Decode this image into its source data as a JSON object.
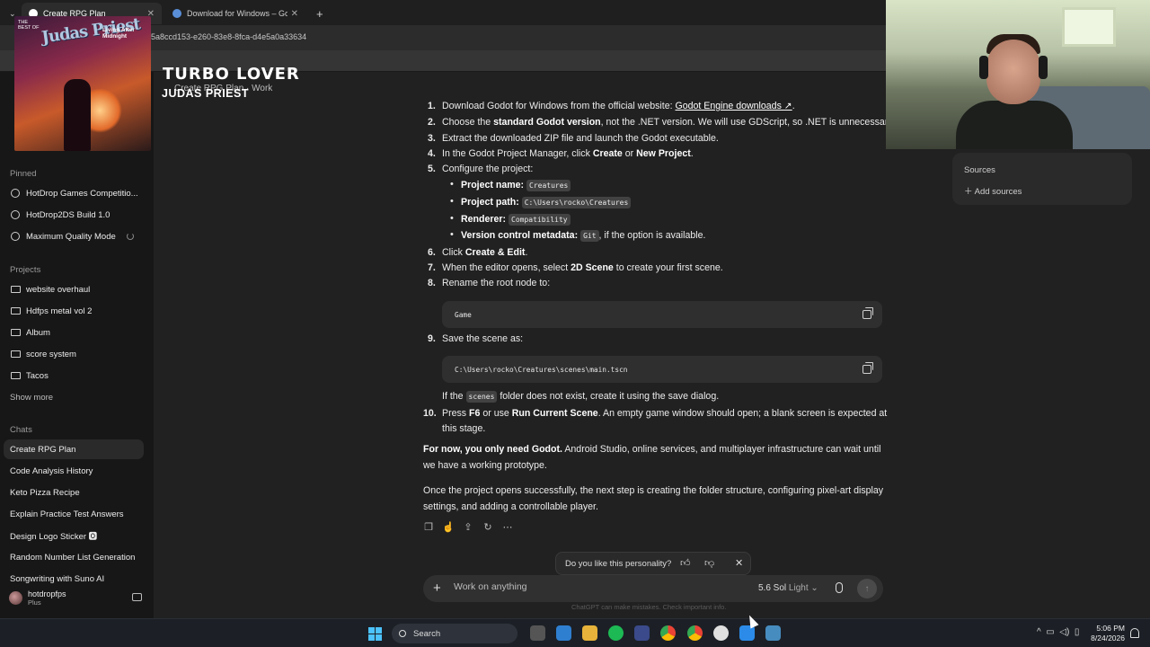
{
  "browser": {
    "tabs": [
      {
        "title": "Create RPG Plan",
        "active": true
      },
      {
        "title": "Download for Windows – Godot",
        "active": false
      }
    ],
    "new_tab": "+",
    "url": "5a8ccd153-e260-83e8-8fca-d4e5a0a33634"
  },
  "overlay": {
    "album_best_of": "THE BEST OF",
    "album_band": "Judas Priest",
    "album_song": "Living After Midnight",
    "now_playing_track": "TURBO LOVER",
    "now_playing_artist": "JUDAS PRIEST"
  },
  "breadcrumb": "Create RPG Plan · Work",
  "sidebar": {
    "pinned_label": "Pinned",
    "pinned": [
      "HotDrop Games Competitio...",
      "HotDrop2DS Build 1.0",
      "Maximum Quality Mode"
    ],
    "projects_label": "Projects",
    "projects": [
      "website overhaul",
      "Hdfps metal vol 2",
      "Album",
      "score system",
      "Tacos"
    ],
    "show_more": "Show more",
    "chats_label": "Chats",
    "chats": [
      "Create RPG Plan",
      "Code Analysis History",
      "Keto Pizza Recipe",
      "Explain Practice Test Answers",
      "Design Logo Sticker 🅾",
      "Random Number List Generation",
      "Songwriting with Suno AI"
    ],
    "user_name": "hotdropfps",
    "user_plan": "Plus"
  },
  "steps": {
    "s1_num": "1.",
    "s1_pre": "Download Godot for Windows from the official website: ",
    "s1_link": "Godot Engine downloads ↗",
    "s1_post": ".",
    "s2_num": "2.",
    "s2_pre": "Choose the ",
    "s2_bold": "standard Godot version",
    "s2_post": ", not the .NET version. We will use GDScript, so .NET is unnecessary.",
    "s3_num": "3.",
    "s3_text": "Extract the downloaded ZIP file and launch the Godot executable.",
    "s4_num": "4.",
    "s4_pre": "In the Godot Project Manager, click ",
    "s4_b1": "Create",
    "s4_mid": " or ",
    "s4_b2": "New Project",
    "s4_post": ".",
    "s5_num": "5.",
    "s5_text": "Configure the project:",
    "cfg_name_label": "Project name:",
    "cfg_name": "Creatures",
    "cfg_path_label": "Project path:",
    "cfg_path": "C:\\Users\\rocko\\Creatures",
    "cfg_renderer_label": "Renderer:",
    "cfg_renderer": "Compatibility",
    "cfg_vcs_label": "Version control metadata:",
    "cfg_vcs": "Git",
    "cfg_vcs_post": ", if the option is available.",
    "s6_num": "6.",
    "s6_pre": "Click ",
    "s6_bold": "Create & Edit",
    "s6_post": ".",
    "s7_num": "7.",
    "s7_pre": "When the editor opens, select ",
    "s7_bold": "2D Scene",
    "s7_post": " to create your first scene.",
    "s8_num": "8.",
    "s8_text": "Rename the root node to:",
    "code1": "Game",
    "s9_num": "9.",
    "s9_text": "Save the scene as:",
    "code2": "C:\\Users\\rocko\\Creatures\\scenes\\main.tscn",
    "s9_note_pre": "If the ",
    "s9_note_code": "scenes",
    "s9_note_post": " folder does not exist, create it using the save dialog.",
    "s10_num": "10.",
    "s10_pre": "Press ",
    "s10_b1": "F6",
    "s10_mid": " or use ",
    "s10_b2": "Run Current Scene",
    "s10_post": ". An empty game window should open; a blank screen is expected at",
    "s10_line2": "this stage.",
    "p1_bold": "For now, you only need Godot.",
    "p1_text": " Android Studio, online services, and multiplayer infrastructure can wait until we have a working prototype.",
    "p2_text": "Once the project opens successfully, the next step is creating the folder structure, configuring pixel-art display settings, and adding a controllable player."
  },
  "sources": {
    "title": "Sources",
    "add": "Add sources"
  },
  "feedback": {
    "question": "Do you like this personality?"
  },
  "composer": {
    "placeholder": "Work on anything",
    "model": "5.6 Sol",
    "mode": "Light"
  },
  "disclaimer": "ChatGPT can make mistakes. Check important info.",
  "taskbar": {
    "search": "Search",
    "time": "5:06 PM",
    "date": "8/24/2026"
  },
  "colors": {
    "main_bg": "#212121",
    "sidebar_bg": "#171717",
    "accent_blue": "#4cc2ff"
  }
}
